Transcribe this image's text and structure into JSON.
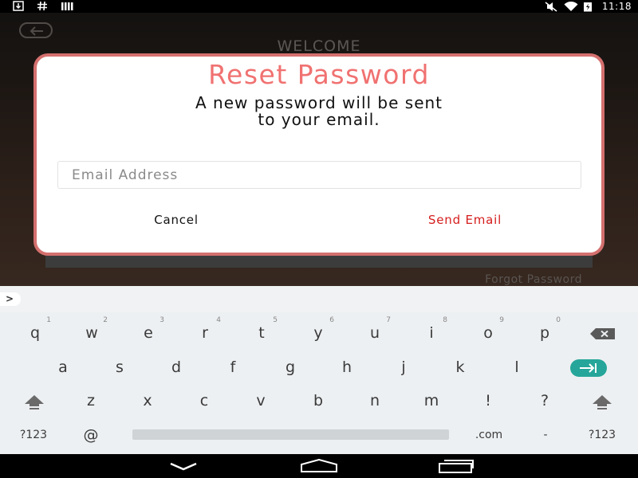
{
  "status_bar": {
    "time": "11:18",
    "left_icons": [
      "download-icon",
      "hash-icon",
      "signal-bars-icon"
    ],
    "right_icons": [
      "mute-icon",
      "wifi-icon",
      "battery-charging-icon"
    ]
  },
  "background": {
    "title": "WELCOME",
    "forgot_link": "Forgot Password"
  },
  "dialog": {
    "title": "Reset Password",
    "message": "A new password will be sent\nto your email.",
    "email_placeholder": "Email Address",
    "email_value": "",
    "cancel_label": "Cancel",
    "send_label": "Send Email",
    "title_color": "#f07271",
    "border_color": "#d4706f",
    "send_color": "#d61e1e"
  },
  "keyboard": {
    "expand_label": ">",
    "row1": [
      {
        "label": "q",
        "hint": "1"
      },
      {
        "label": "w",
        "hint": "2"
      },
      {
        "label": "e",
        "hint": "3"
      },
      {
        "label": "r",
        "hint": "4"
      },
      {
        "label": "t",
        "hint": "5"
      },
      {
        "label": "y",
        "hint": "6"
      },
      {
        "label": "u",
        "hint": "7"
      },
      {
        "label": "i",
        "hint": "8"
      },
      {
        "label": "o",
        "hint": "9"
      },
      {
        "label": "p",
        "hint": "0"
      }
    ],
    "row2": [
      "a",
      "s",
      "d",
      "f",
      "g",
      "h",
      "j",
      "k",
      "l"
    ],
    "row3": [
      "z",
      "x",
      "c",
      "v",
      "b",
      "n",
      "m",
      "!",
      "?"
    ],
    "row4": {
      "symbols": "?123",
      "at": "@",
      "dotcom": ".com",
      "dash": "-",
      "symbols_right": "?123"
    },
    "accent_color": "#26a69a"
  }
}
